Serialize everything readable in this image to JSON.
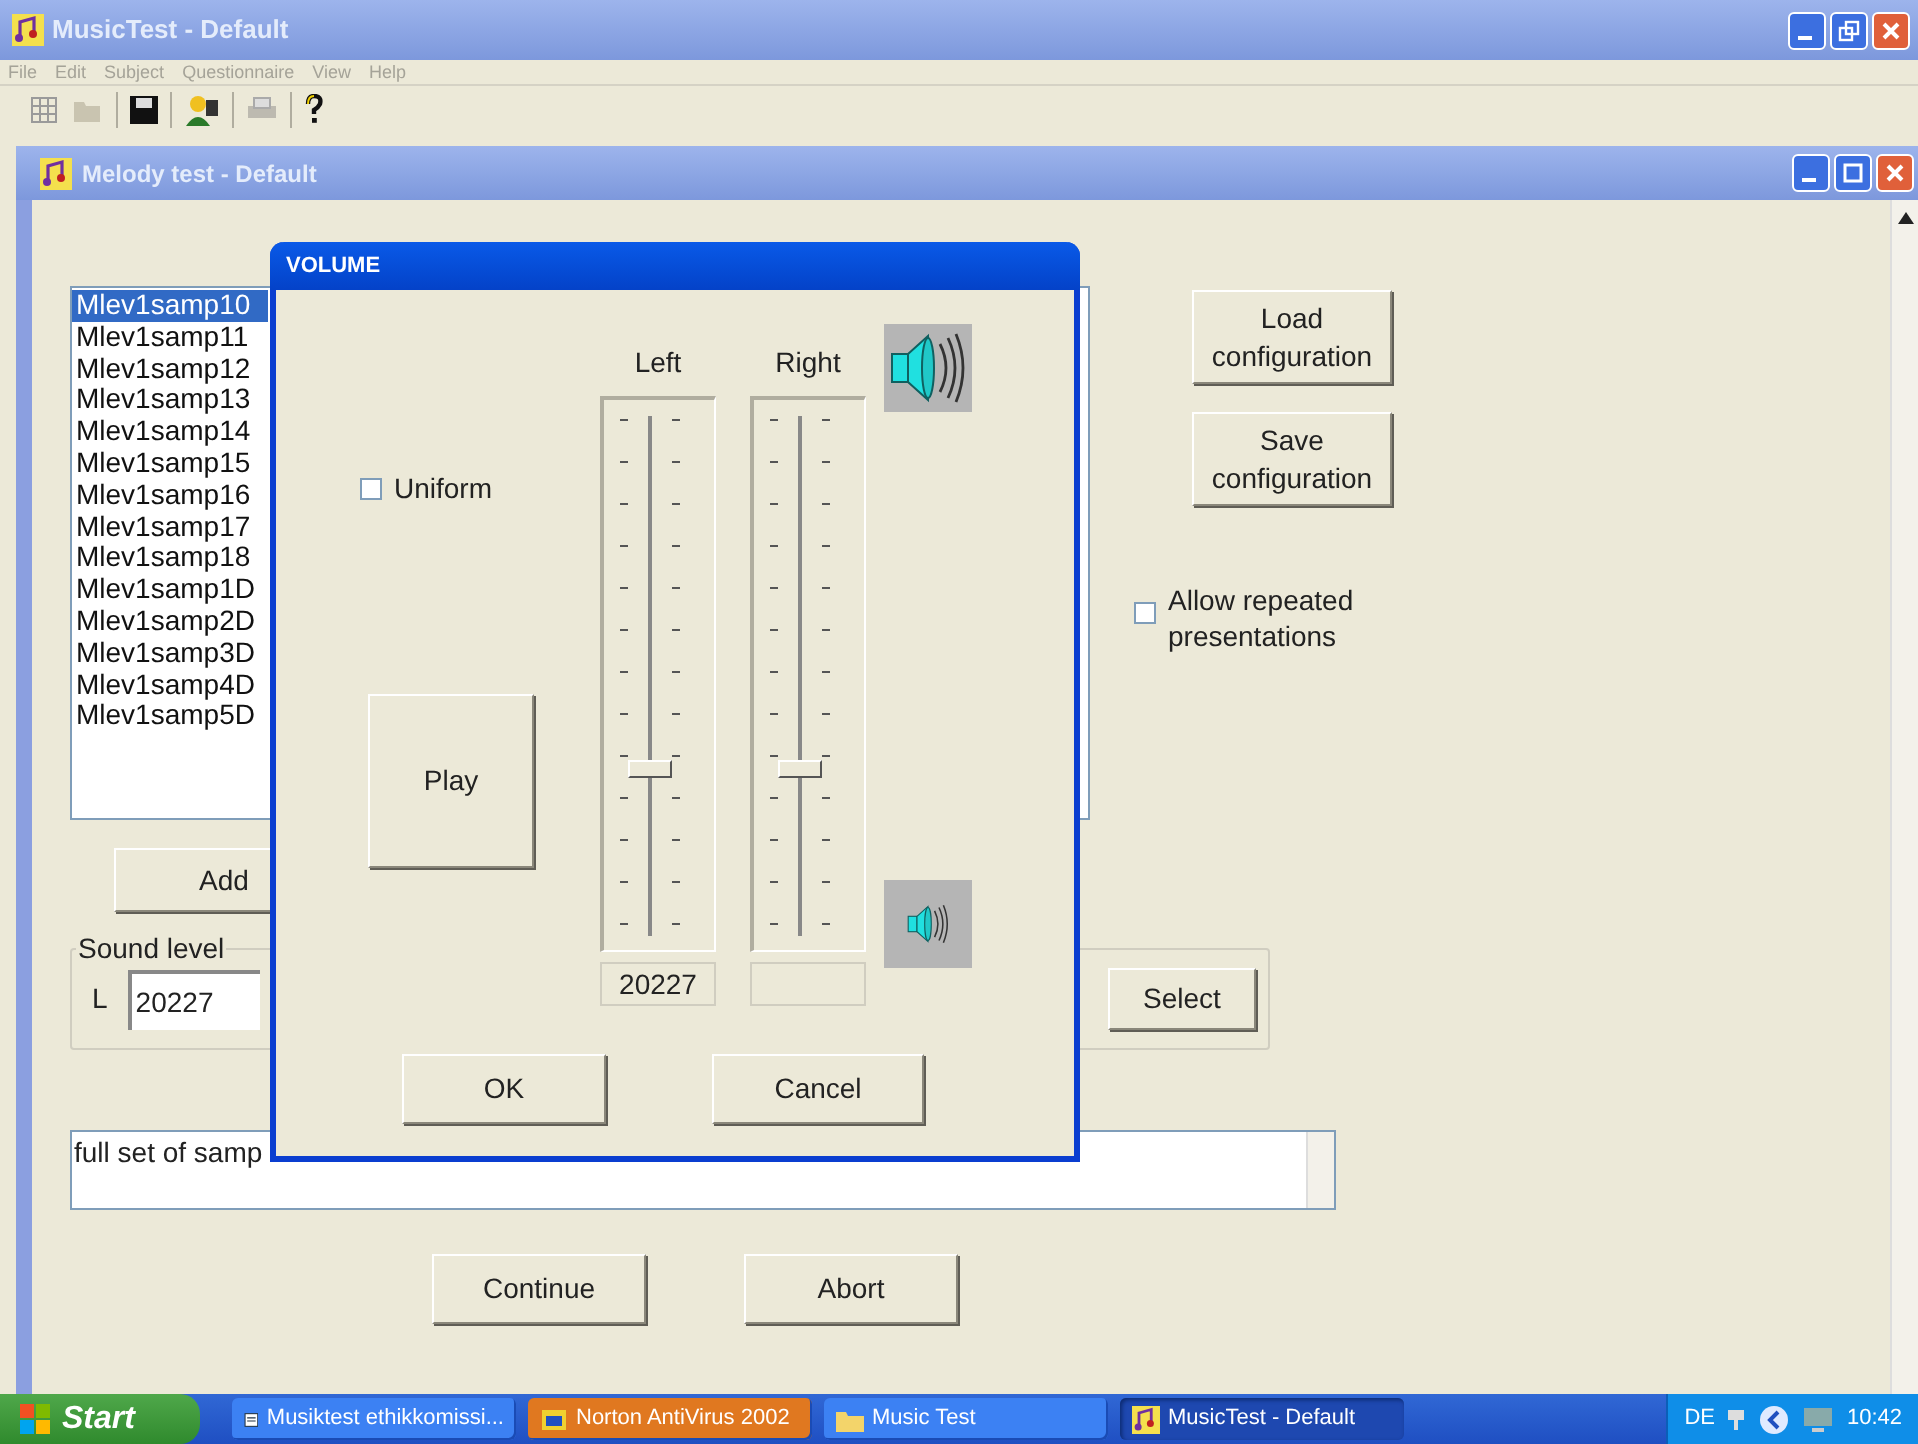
{
  "app_window": {
    "title": "MusicTest - Default"
  },
  "menu": [
    "File",
    "Edit",
    "Subject",
    "Questionnaire",
    "View",
    "Help"
  ],
  "child_window": {
    "title": "Melody test - Default"
  },
  "sample_list": [
    {
      "label": "Mlev1samp10",
      "selected": true
    },
    {
      "label": "Mlev1samp11",
      "selected": false
    },
    {
      "label": "Mlev1samp12",
      "selected": false
    },
    {
      "label": "Mlev1samp13",
      "selected": false
    },
    {
      "label": "Mlev1samp14",
      "selected": false
    },
    {
      "label": "Mlev1samp15",
      "selected": false
    },
    {
      "label": "Mlev1samp16",
      "selected": false
    },
    {
      "label": "Mlev1samp17",
      "selected": false
    },
    {
      "label": "Mlev1samp18",
      "selected": false
    },
    {
      "label": "Mlev1samp1D",
      "selected": false
    },
    {
      "label": "Mlev1samp2D",
      "selected": false
    },
    {
      "label": "Mlev1samp3D",
      "selected": false
    },
    {
      "label": "Mlev1samp4D",
      "selected": false
    },
    {
      "label": "Mlev1samp5D",
      "selected": false
    }
  ],
  "add_button": "Add",
  "config_buttons": [
    "Load configuration",
    "Save configuration"
  ],
  "allow_repeated": {
    "label": "Allow repeated presentations",
    "checked": false
  },
  "sound_level": {
    "label": "Sound level",
    "channel": "L",
    "value": "20227",
    "select_button": "Select"
  },
  "description": "full set of samp",
  "actions": [
    "Continue",
    "Abort"
  ],
  "volume_dialog": {
    "title": "VOLUME",
    "uniform": {
      "label": "Uniform",
      "checked": false
    },
    "play_button": "Play",
    "channels": [
      {
        "name": "Left",
        "level": 0.31,
        "value": "20227"
      },
      {
        "name": "Right",
        "level": 0.31
      }
    ],
    "ok_button": "OK",
    "cancel_button": "Cancel"
  },
  "taskbar": {
    "start": "Start",
    "tasks": [
      {
        "label": "Musiktest ethikkomissi...",
        "kind": "document",
        "selected": false,
        "flashing": false
      },
      {
        "label": "Norton AntiVirus 2002",
        "kind": "app",
        "selected": false,
        "flashing": true
      },
      {
        "label": "Music Test",
        "kind": "folder",
        "selected": false,
        "flashing": false
      },
      {
        "label": "MusicTest - Default",
        "kind": "music",
        "selected": true,
        "flashing": false
      }
    ],
    "language": "DE",
    "clock": "10:42"
  }
}
